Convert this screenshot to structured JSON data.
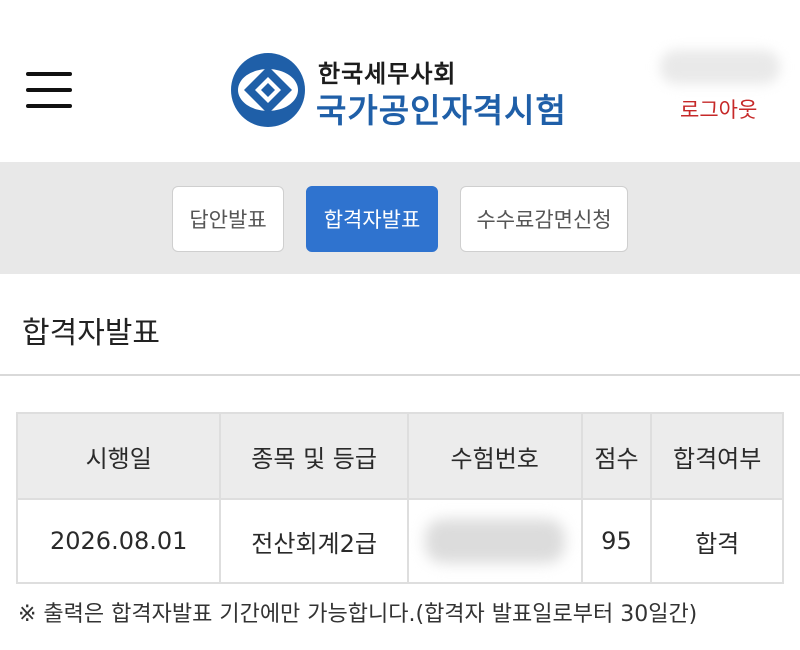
{
  "header": {
    "logo_org": "한국세무사회",
    "logo_title": "국가공인자격시험",
    "logout_label": "로그아웃",
    "colors": {
      "brand": "#1f5fa8",
      "logout": "#c62828"
    }
  },
  "tabs": [
    {
      "label": "답안발표",
      "active": false
    },
    {
      "label": "합격자발표",
      "active": true
    },
    {
      "label": "수수료감면신청",
      "active": false
    }
  ],
  "section": {
    "title": "합격자발표"
  },
  "table": {
    "headers": [
      "시행일",
      "종목 및 등급",
      "수험번호",
      "점수",
      "합격여부"
    ],
    "rows": [
      {
        "date": "2026.08.01",
        "subject": "전산회계2급",
        "exam_number": "",
        "score": "95",
        "result": "합격"
      }
    ]
  },
  "note": "※ 출력은 합격자발표 기간에만 가능합니다.(합격자 발표일로부터 30일간)",
  "accent_color": "#2f73cf"
}
